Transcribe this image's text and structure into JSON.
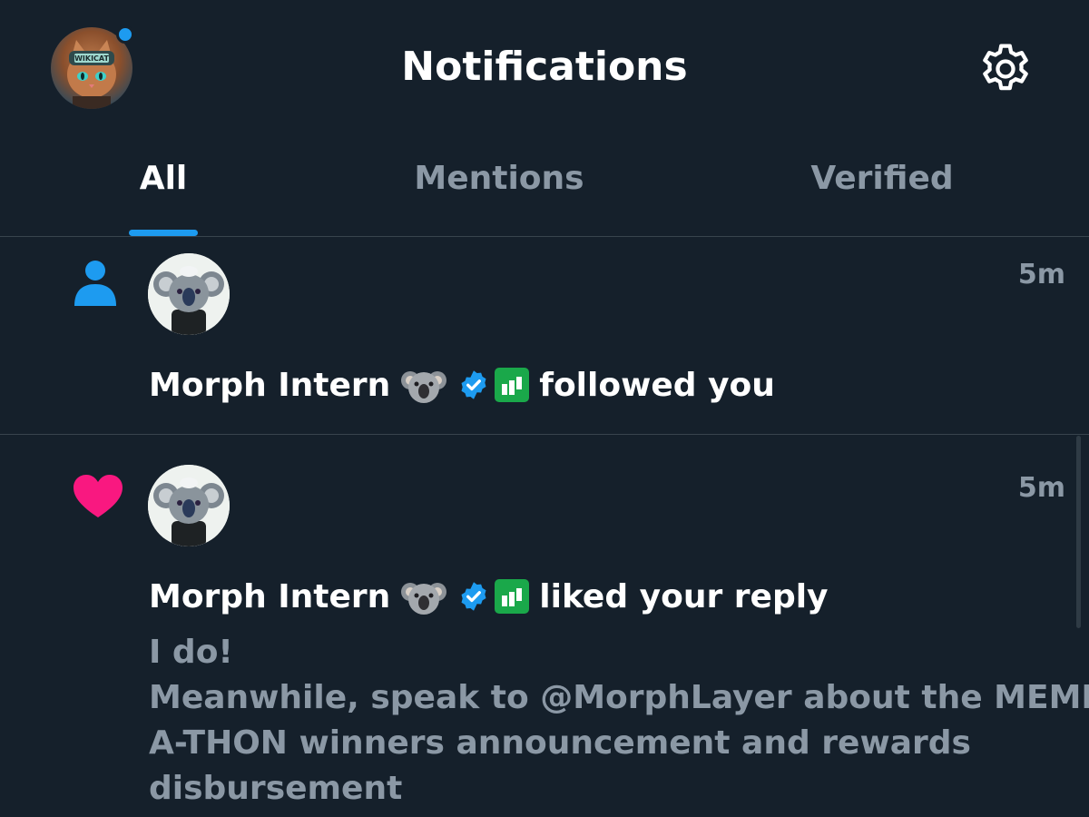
{
  "header": {
    "title": "Notifications",
    "avatar_icon": "profile-avatar-cat",
    "avatar_text": "WIKICAT",
    "settings_icon": "gear-icon"
  },
  "tabs": [
    {
      "label": "All",
      "active": true
    },
    {
      "label": "Mentions",
      "active": false
    },
    {
      "label": "Verified",
      "active": false
    }
  ],
  "notifications": [
    {
      "type": "follow",
      "type_icon": "person-icon",
      "actor": "Morph Intern",
      "action": "followed you",
      "time": "5m"
    },
    {
      "type": "like",
      "type_icon": "heart-icon",
      "actor": "Morph Intern",
      "action": "liked your reply",
      "time": "5m",
      "reply_lines": [
        "I do!",
        "Meanwhile, speak to @MorphLayer about the MEME-",
        "A-THON winners announcement and rewards",
        "disbursement"
      ]
    }
  ],
  "colors": {
    "background": "#15202b",
    "accent": "#1d9bf0",
    "secondary_text": "#8b98a5",
    "divider": "#38444d",
    "like": "#f91880",
    "affiliate_badge": "#1aa84a"
  }
}
